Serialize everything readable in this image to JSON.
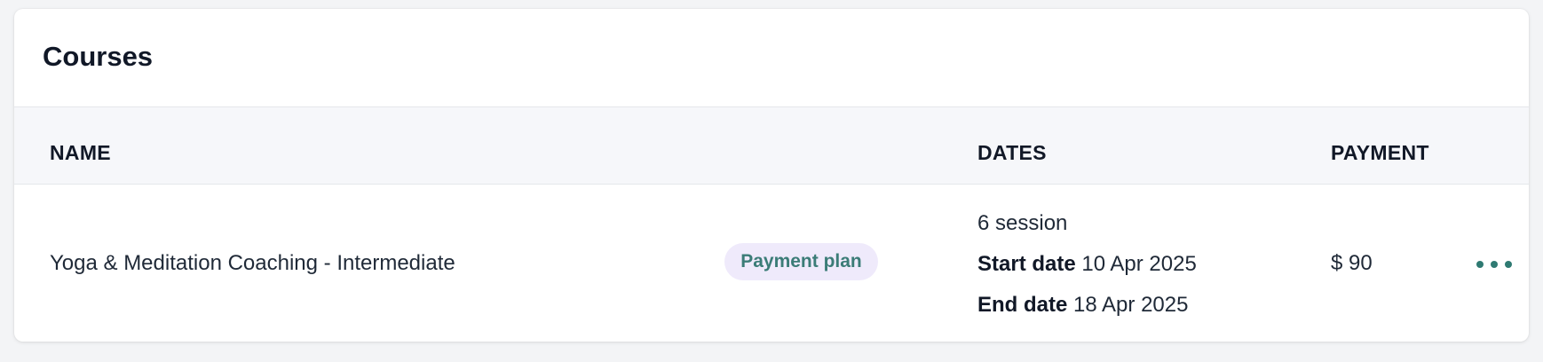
{
  "card": {
    "title": "Courses"
  },
  "table": {
    "headers": {
      "name": "NAME",
      "dates": "DATES",
      "payment": "PAYMENT"
    },
    "rows": [
      {
        "name": "Yoga & Meditation Coaching - Intermediate",
        "badge": "Payment plan",
        "sessions": "6 session",
        "start_label": "Start date",
        "start_value": " 10 Apr 2025",
        "end_label": "End date",
        "end_value": " 18 Apr 2025",
        "payment": "$ 90",
        "menu_icon": "more-horizontal-icon"
      }
    ]
  },
  "colors": {
    "accent": "#2f7a72",
    "badge_bg": "#efeafb",
    "header_bg": "#f6f7fa"
  }
}
